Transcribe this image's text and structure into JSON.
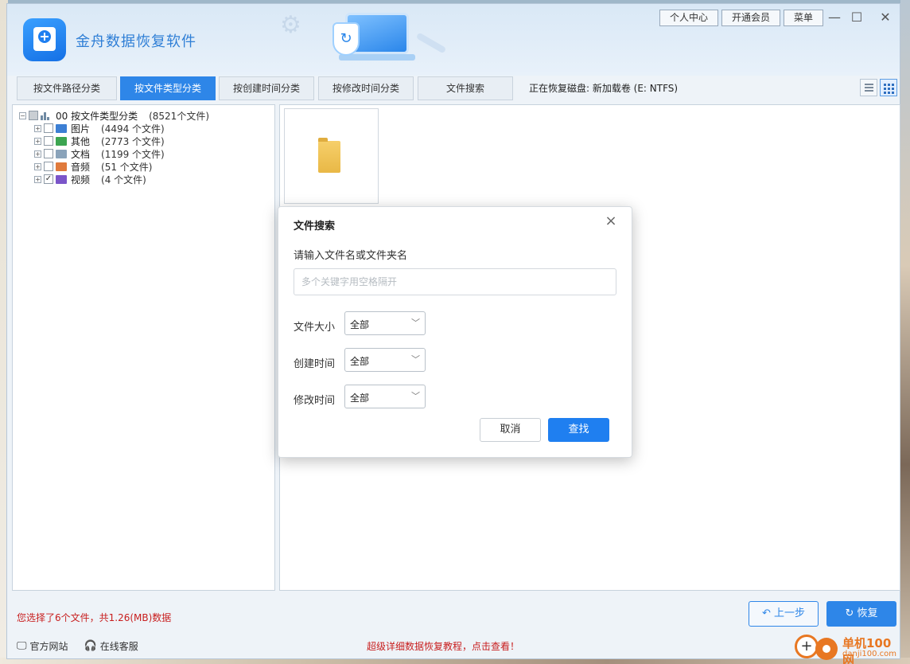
{
  "app": {
    "title": "金舟数据恢复软件"
  },
  "top_buttons": [
    "个人中心",
    "开通会员",
    "菜单"
  ],
  "window_controls": {
    "minimize": "—",
    "maximize": "☐",
    "close": "✕"
  },
  "tabs": [
    {
      "label": "按文件路径分类",
      "active": false
    },
    {
      "label": "按文件类型分类",
      "active": true
    },
    {
      "label": "按创建时间分类",
      "active": false
    },
    {
      "label": "按修改时间分类",
      "active": false
    },
    {
      "label": "文件搜索",
      "active": false
    }
  ],
  "disk_info": "正在恢复磁盘: 新加载卷 (E: NTFS)",
  "tree": {
    "root": {
      "expander": "−",
      "label": "00 按文件类型分类",
      "count": "(8521个文件)",
      "checked": "partial"
    },
    "items": [
      {
        "label": "图片",
        "count": "(4494 个文件)",
        "checked": false,
        "icon_color": "#3c7fd4"
      },
      {
        "label": "其他",
        "count": "(2773 个文件)",
        "checked": false,
        "icon_color": "#3ca551"
      },
      {
        "label": "文档",
        "count": "(1199 个文件)",
        "checked": false,
        "icon_color": "#8aa3ba"
      },
      {
        "label": "音频",
        "count": "(51 个文件)",
        "checked": false,
        "icon_color": "#e07a3c"
      },
      {
        "label": "视频",
        "count": "(4 个文件)",
        "checked": true,
        "icon_color": "#7b55c9"
      }
    ]
  },
  "bottom": {
    "selection": "您选择了6个文件，共1.26(MB)数据",
    "official_site": "官方网站",
    "online_service": "在线客服",
    "promo": "超级详细数据恢复教程，点击查看！",
    "prev_button": "上一步",
    "recover_button": "恢复"
  },
  "watermark": {
    "line1": "单机100网",
    "line2": "danji100.com"
  },
  "dialog": {
    "title": "文件搜索",
    "prompt": "请输入文件名或文件夹名",
    "input_value": "",
    "input_placeholder": "多个关键字用空格隔开",
    "filters": [
      {
        "label": "文件大小",
        "value": "全部"
      },
      {
        "label": "创建时间",
        "value": "全部"
      },
      {
        "label": "修改时间",
        "value": "全部"
      }
    ],
    "cancel": "取消",
    "search": "查找"
  },
  "colors": {
    "accent": "#2e86e8",
    "danger": "#c81e1e",
    "watermark": "#e87722"
  }
}
